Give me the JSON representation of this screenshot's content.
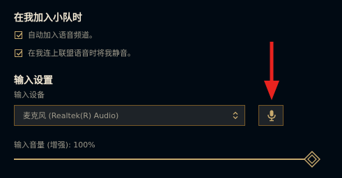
{
  "team_section": {
    "title": "在我加入小队时",
    "options": [
      {
        "label": "自动加入语音频道。",
        "checked": true
      },
      {
        "label": "在我连上联盟语音时将我静音。",
        "checked": true
      }
    ]
  },
  "input_section": {
    "title": "输入设置",
    "device_label": "输入设备",
    "device_selected": "麦克风 (Realtek(R) Audio)",
    "volume_label": "输入音量 (增强): 100%",
    "volume_value": 100
  },
  "icons": {
    "checkbox_mark": "checkmark-icon",
    "select_arrows": "chevron-up-down-icon",
    "mic_button": "microphone-icon",
    "annotation": "red-arrow-down-icon",
    "slider_thumb": "diamond-thumb-icon"
  },
  "colors": {
    "background": "#010a13",
    "gold": "#c8aa6e",
    "gold_dark": "#785a28",
    "title_text": "#f0e6d2",
    "body_text": "#a09b8c",
    "annotation_red": "#e8231f"
  }
}
